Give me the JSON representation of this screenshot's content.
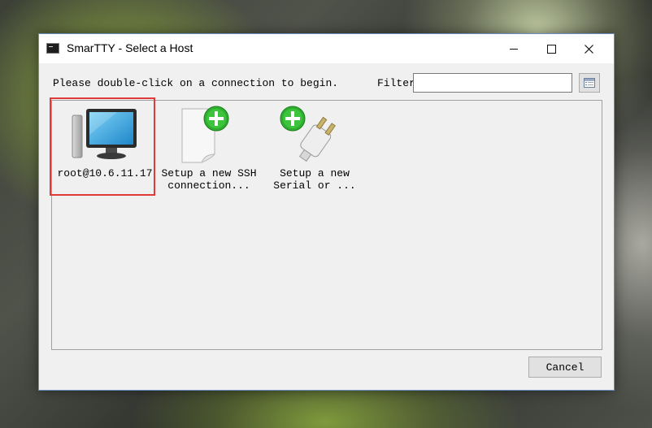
{
  "window": {
    "title": "SmarTTY - Select a Host",
    "app_icon": "terminal-icon",
    "controls": [
      "minimize-icon",
      "maximize-icon",
      "close-icon"
    ]
  },
  "dialog": {
    "instruction": "Please double-click on a connection to begin.",
    "filter_label": "Filter",
    "filter_value": "",
    "filter_button_icon": "list-view-icon"
  },
  "hosts": [
    {
      "label": "root@10.6.11.17",
      "icon": "computer-monitor-icon",
      "selected": true
    },
    {
      "label": "Setup a new SSH\nconnection...",
      "icon": "new-document-plus-icon",
      "selected": false
    },
    {
      "label": "Setup a new\nSerial or ...",
      "icon": "plug-plus-icon",
      "selected": false
    }
  ],
  "buttons": {
    "cancel": "Cancel"
  },
  "colors": {
    "selection_border": "#e03a3a",
    "window_border": "#6b8fc4",
    "plus_green": "#2fae2f"
  }
}
